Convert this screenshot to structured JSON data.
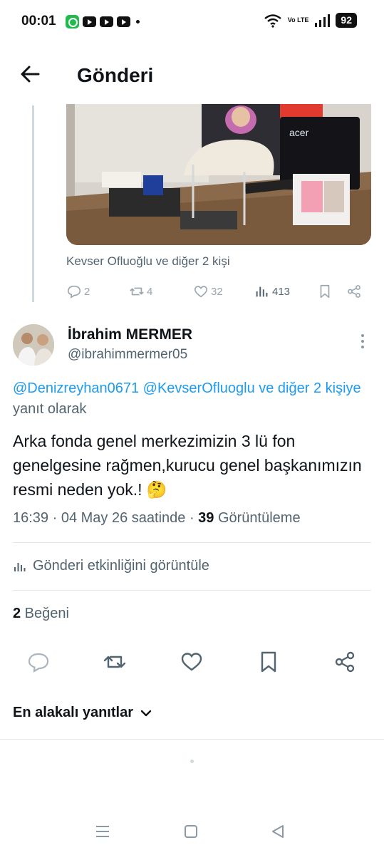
{
  "status_bar": {
    "time": "00:01",
    "network": "Vo LTE",
    "battery": "92",
    "app_icons": [
      "whatsapp-icon",
      "youtube-icon",
      "youtube-icon",
      "youtube-icon"
    ]
  },
  "header": {
    "title": "Gönderi"
  },
  "parent_post": {
    "image_alt": "office-photo",
    "tagged_text": "Kevser Ofluoğlu ve diğer 2 kişi",
    "stats": {
      "replies": "2",
      "reposts": "4",
      "likes": "32",
      "views": "413"
    }
  },
  "post": {
    "author_name": "İbrahim MERMER",
    "author_handle": "@ibrahimmermer05",
    "reply_mention_1": "@Denizreyhan0671",
    "reply_mention_2": "@KevserOfluoglu ve diğer 2 kişiye",
    "reply_suffix": "yanıt olarak",
    "text": "Arka fonda genel merkezimizin 3 lü fon genelgesine rağmen,kurucu genel başkanımızın resmi neden yok.! 🤔",
    "time": "16:39 · 04 May 26 saatinde · ",
    "views_count": "39",
    "views_label": " Görüntüleme",
    "activity_label": "Gönderi etkinliğini görüntüle",
    "likes_count": "2",
    "likes_label": " Beğeni"
  },
  "sort": {
    "label": "En alakalı yanıtlar"
  },
  "colors": {
    "accent": "#1d9bf0",
    "text": "#0f1419",
    "secondary": "#536471",
    "border": "#e1e8ed"
  }
}
